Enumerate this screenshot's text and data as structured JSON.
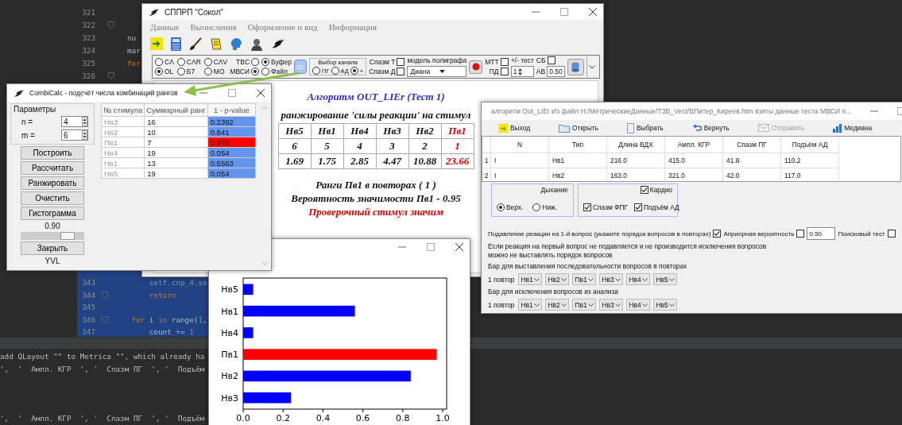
{
  "ide": {
    "top_lines": [
      {
        "number": "321",
        "fold": false
      },
      {
        "number": "322",
        "fold": true
      },
      {
        "number": "323",
        "fold": false,
        "tokens": [
          {
            "text": "nu",
            "kind": "plain"
          }
        ]
      },
      {
        "number": "324",
        "fold": false,
        "tokens": [
          {
            "text": "mar",
            "kind": "plain"
          }
        ]
      },
      {
        "number": "325",
        "fold": false,
        "tokens": [
          {
            "text": "for",
            "kind": "keyword"
          }
        ]
      },
      {
        "number": "326",
        "fold": true
      }
    ],
    "lower_lines": [
      {
        "number": "343",
        "fold": false,
        "tokens": [
          {
            "text": "        self.cnp_4.se",
            "kind": "dim"
          }
        ]
      },
      {
        "number": "344",
        "fold": true,
        "tokens": [
          {
            "text": "        return",
            "kind": "keyword"
          }
        ]
      },
      {
        "number": "345",
        "fold": false
      },
      {
        "number": "346",
        "fold": true,
        "tokens": [
          {
            "text": "    for",
            "kind": "keyword"
          },
          {
            "text": " i ",
            "kind": "plain"
          },
          {
            "text": "in",
            "kind": "keyword"
          },
          {
            "text": " range(",
            "kind": "plain"
          },
          {
            "text": "1",
            "kind": "number"
          },
          {
            "text": ",",
            "kind": "plain"
          }
        ]
      },
      {
        "number": "347",
        "fold": false,
        "tokens": [
          {
            "text": "        count += ",
            "kind": "plain"
          },
          {
            "text": "1",
            "kind": "number"
          }
        ]
      }
    ],
    "console": [
      "add QLayout \"\" to Metrica \"\", which already ha",
      "',  '  Ампл. КГР  ', '  Спазм ПГ  ', '  Подъём",
      "',  '  Ампл. КГР  ', '  Спазм ПГ  ', '  Подъём"
    ]
  },
  "main_window": {
    "title": "СППРП \"Сокол\"",
    "menu": [
      "Данные",
      "Вычисления",
      "Оформление и вид",
      "Информация"
    ],
    "panel": {
      "mode_radios": [
        {
          "label": "CΛ",
          "selected": false
        },
        {
          "label": "CΛR",
          "selected": false
        },
        {
          "label": "CΛV",
          "selected": false
        },
        {
          "label": "OL",
          "selected": true
        },
        {
          "label": "Б7",
          "selected": false
        },
        {
          "label": "MO",
          "selected": false
        }
      ],
      "test_radios": [
        {
          "label": "TBC",
          "selected": false
        },
        {
          "label": "МВСИ",
          "selected": true
        }
      ],
      "source_radios": [
        {
          "label": "Буфер",
          "selected": true
        },
        {
          "label": "Файл",
          "selected": false
        }
      ],
      "cc_button": "CC",
      "channel": {
        "title": "Выбор канала",
        "options": [
          {
            "label": "ПГ",
            "selected": false
          },
          {
            "label": "АД",
            "selected": false
          },
          {
            "label": "+",
            "selected": true
          }
        ]
      },
      "spasm_checks": [
        {
          "label": "Спазм Т",
          "checked": false
        },
        {
          "label": "Спазм Д",
          "checked": false
        }
      ],
      "polygraph": {
        "label": "модель полиграфа",
        "value": "Диана"
      },
      "mtt_checks": [
        {
          "label": "МТТ",
          "checked": false
        },
        {
          "label": "ПД",
          "checked": false
        }
      ],
      "test_label": "+/- тест",
      "test_spin": "1",
      "sb": {
        "label": "СБ",
        "checked": false
      },
      "av": {
        "label": "АВ",
        "value": "0.50"
      }
    },
    "report": {
      "title": "Алгоритм OUT_LIEr (Тест 1)",
      "subtitle": "ранжирование 'силы реакции' на стимул",
      "columns": [
        {
          "stimulus": "Нв5",
          "rank": "6",
          "value": "1.69",
          "highlight": false
        },
        {
          "stimulus": "Нв1",
          "rank": "5",
          "value": "1.75",
          "highlight": false
        },
        {
          "stimulus": "Нв4",
          "rank": "4",
          "value": "2.85",
          "highlight": false
        },
        {
          "stimulus": "Нв3",
          "rank": "3",
          "value": "4.47",
          "highlight": false
        },
        {
          "stimulus": "Нв2",
          "rank": "2",
          "value": "10.88",
          "highlight": false
        },
        {
          "stimulus": "Пв1",
          "rank": "1",
          "value": "23.66",
          "highlight": true
        }
      ],
      "lines": [
        {
          "text": "Ранги Пв1 в повторах ( 1 )",
          "kind": "normal"
        },
        {
          "text": "Вероятность значимости Пв1 - 0.95",
          "kind": "normal"
        },
        {
          "text": "Проверочный стимул значим",
          "kind": "alert"
        }
      ]
    }
  },
  "combicalc": {
    "title": "CombiCalc - подсчёт числа комбинаций рангов",
    "params": {
      "title": "Параметры",
      "fields": [
        {
          "label": "n =",
          "value": "4"
        },
        {
          "label": "m =",
          "value": "6"
        }
      ]
    },
    "buttons": [
      "Построить",
      "Рассчитать",
      "Ранжировать",
      "Очистить",
      "Гистограмма"
    ],
    "slider": {
      "reading": "0.90",
      "level": 0.8
    },
    "close_button": "Закрыть",
    "footer": "YVL",
    "table": {
      "columns": [
        "№ стимула",
        "Суммарный ранг",
        "1 - p-value"
      ],
      "rows": [
        {
          "stimulus": "Нв3",
          "sum_rank": "16",
          "p": "0.2392",
          "color": "#6495ed"
        },
        {
          "stimulus": "Нв2",
          "sum_rank": "10",
          "p": "0.841",
          "color": "#6495ed"
        },
        {
          "stimulus": "Пв1",
          "sum_rank": "7",
          "p": "0.973",
          "color": "#ff0000"
        },
        {
          "stimulus": "Нв4",
          "sum_rank": "19",
          "p": "0.054",
          "color": "#6495ed"
        },
        {
          "stimulus": "Нв1",
          "sum_rank": "13",
          "p": "0.5563",
          "color": "#6495ed"
        },
        {
          "stimulus": "Нв5",
          "sum_rank": "19",
          "p": "0.054",
          "color": "#6495ed"
        }
      ]
    }
  },
  "chart_window": {
    "chart_data": {
      "type": "bar",
      "orientation": "horizontal",
      "categories": [
        "Нв5",
        "Нв1",
        "Нв4",
        "Пв1",
        "Нв2",
        "Нв3"
      ],
      "series": [
        {
          "color": "#0000ff",
          "values": [
            0.05,
            0.56,
            0.05,
            null,
            0.84,
            0.24
          ]
        },
        {
          "color": "#ff0000",
          "values": [
            null,
            null,
            null,
            0.97,
            null,
            null
          ]
        }
      ],
      "xlim": [
        0,
        1.02
      ],
      "xticks": [
        {
          "value": 0,
          "label": "0.0"
        },
        {
          "value": 0.2,
          "label": "0.2"
        },
        {
          "value": 0.4,
          "label": "0.4"
        },
        {
          "value": 0.6,
          "label": "0.6"
        },
        {
          "value": 0.8,
          "label": "0.8"
        },
        {
          "value": 1,
          "label": "1.0"
        }
      ]
    }
  },
  "outlier_window": {
    "title": "алгоритм Out_LIEr  Из файл H:/МетрическиеДанные/ТЗВ_Vect/ВПитер_Киреев.htm взяты данные теста МВСИ п...",
    "toolbar": [
      {
        "label": "Выход",
        "kind": "exit",
        "disabled": false
      },
      {
        "label": "Открыть",
        "kind": "folder",
        "disabled": false
      },
      {
        "label": "Выбрать",
        "kind": "column",
        "disabled": false
      },
      {
        "label": "Вернуть",
        "kind": "undo",
        "disabled": false
      },
      {
        "label": "Отправить",
        "kind": "mail",
        "disabled": true
      },
      {
        "label": "Медиана",
        "kind": "chart",
        "disabled": false
      }
    ],
    "table": {
      "columns": [
        "N",
        "Тип",
        "Длина ВДХ",
        "Ампл. КГР",
        "Спазм ПГ",
        "Подъём АД"
      ],
      "rows": [
        {
          "index": "1",
          "cells": [
            "I",
            "Нв1",
            "216.0",
            "415.0",
            "41.8",
            "110.2"
          ]
        },
        {
          "index": "2",
          "cells": [
            "I",
            "Нв2",
            "163.0",
            "321.0",
            "42.0",
            "117.0"
          ]
        }
      ]
    },
    "breathing": {
      "title": "Дыхание",
      "options": [
        {
          "label": "Верх.",
          "selected": true
        },
        {
          "label": "Ниж.",
          "selected": false
        }
      ]
    },
    "cardio": {
      "label": "Кардио",
      "checked": true,
      "options": [
        {
          "label": "Спазм ФПГ",
          "checked": true
        },
        {
          "label": "Подъём АД",
          "checked": true
        }
      ]
    },
    "suppress": {
      "label": "Подавление реакции на 1-й вопрос (укажите порядок вопросов в повторах)",
      "checked": true
    },
    "prior": {
      "label": "Априорная вероятность",
      "checked": false,
      "value": "0.50"
    },
    "search_test": {
      "label": "Поисковый тест",
      "checked": false
    },
    "note": [
      "Если реакция на первый вопрос не подавляется и не производится исключения вопросов",
      "можно не выставлять порядок вопросов"
    ],
    "order_bar": {
      "label": "Бар для выставления последовательности вопросов в повторах",
      "row_label": "1 повтор",
      "combos": [
        "Нв1",
        "Нв2",
        "Пв1",
        "Нв3",
        "Нв4",
        "Нв5"
      ]
    },
    "exclude_bar": {
      "label": "Бар для исключения вопросов из анализа",
      "row_label": "1 повтор",
      "combos": [
        "Нв1",
        "Нв2",
        "Пв1",
        "Нв3",
        "Нв4",
        "Нв5"
      ]
    }
  }
}
